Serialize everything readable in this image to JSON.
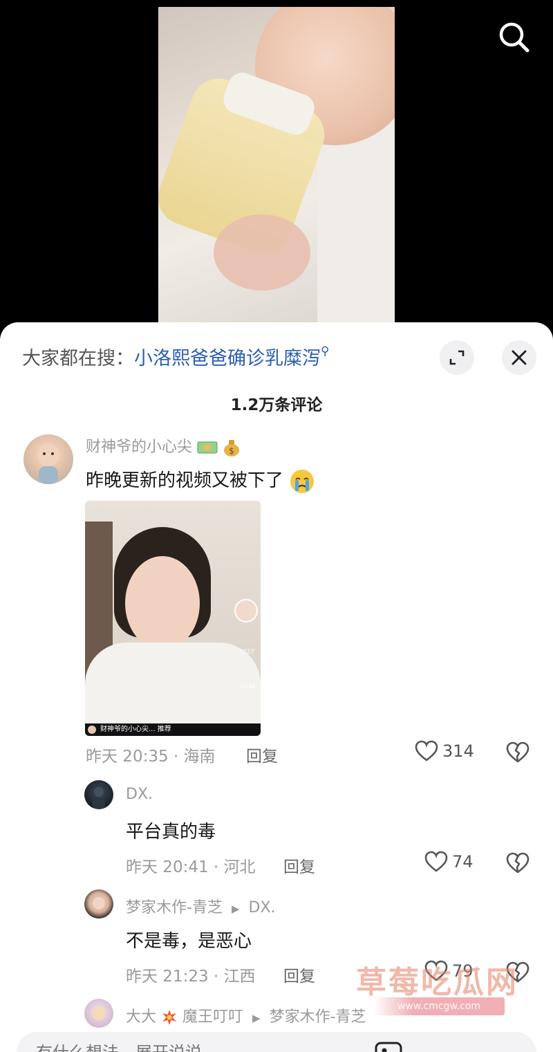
{
  "video": {
    "search_icon": "search-icon"
  },
  "panel": {
    "hot_search_prefix": "大家都在搜：",
    "hot_search_query": "小洛熙爸爸确诊乳糜泻",
    "expand_icon": "expand-icon",
    "close_icon": "close-icon",
    "comment_count": "1.2万条评论"
  },
  "comments": [
    {
      "nickname": "财神爷的小心尖",
      "nickname_emojis": [
        "money-bills-emoji",
        "money-bag-emoji"
      ],
      "text": "昨晚更新的视频又被下了",
      "text_emoji": "crying-face-emoji",
      "image": {
        "caption": "财神爷的小心尖...  推荐",
        "count1": "3027",
        "count2": "1038"
      },
      "time": "昨天 20:35 · 海南",
      "reply_label": "回复",
      "likes": "314"
    },
    {
      "nickname": "DX.",
      "text": "平台真的毒",
      "time": "昨天 20:41 · 河北",
      "reply_label": "回复",
      "likes": "74"
    },
    {
      "nickname": "梦家木作-青芝",
      "reply_to": "DX.",
      "text": "不是毒，是恶心",
      "time": "昨天 21:23 · 江西",
      "reply_label": "回复",
      "likes": "79"
    },
    {
      "nickname": "大大",
      "nickname_suffix": "魔王叮叮",
      "reply_to": "梦家木作-青芝"
    }
  ],
  "input": {
    "placeholder": "有什么想法，展开说说"
  },
  "watermark": {
    "title": "草莓吃瓜网",
    "url": "www.cmcgw.com"
  },
  "colors": {
    "accent_link": "#2b5eb0",
    "muted_text": "#9a9a9a",
    "watermark": "#e28064"
  }
}
